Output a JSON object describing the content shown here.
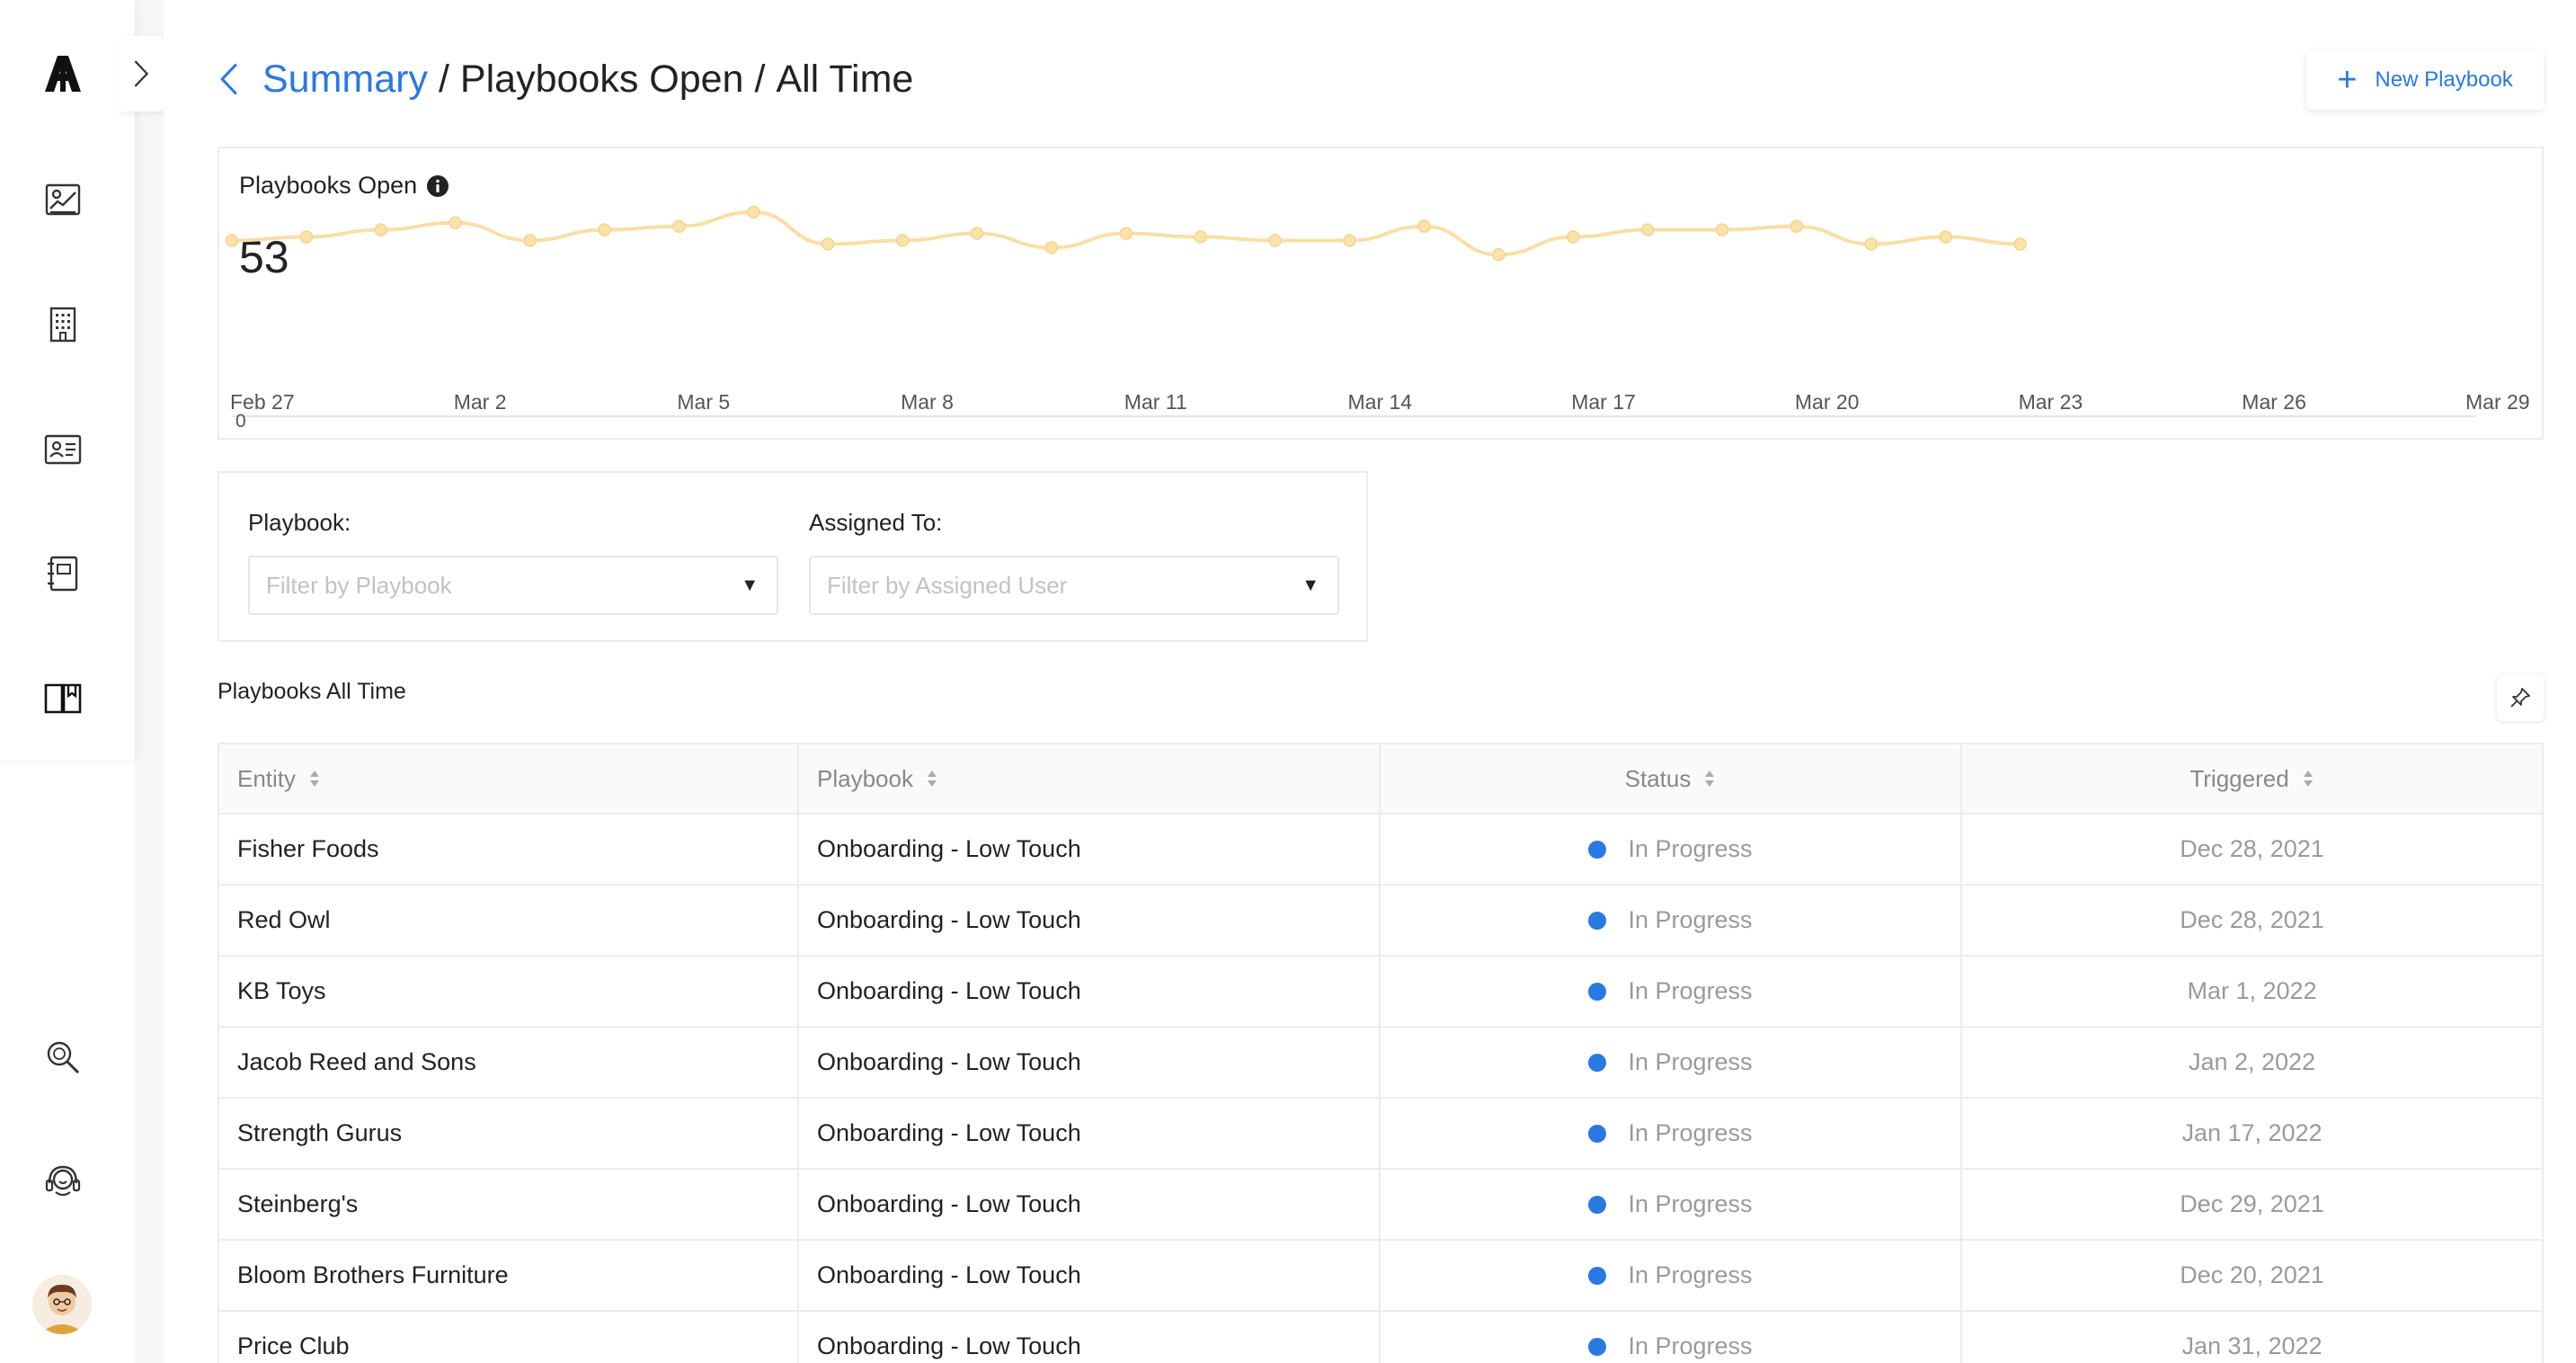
{
  "sidebar": {
    "logo": "A",
    "items": [
      {
        "name": "analytics-icon"
      },
      {
        "name": "building-icon"
      },
      {
        "name": "contacts-icon"
      },
      {
        "name": "notebook-icon"
      },
      {
        "name": "book-icon"
      }
    ],
    "bottom_items": [
      {
        "name": "search-icon"
      },
      {
        "name": "support-headset-icon"
      }
    ]
  },
  "header": {
    "breadcrumb_link": "Summary",
    "separator": "/",
    "crumb_2": "Playbooks Open",
    "crumb_3": "All Time",
    "new_button_label": "New Playbook"
  },
  "chart_card": {
    "title": "Playbooks Open",
    "value": "53"
  },
  "chart_data": {
    "type": "line",
    "x": [
      "Feb 27",
      "Feb 28",
      "Mar 1",
      "Mar 2",
      "Mar 3",
      "Mar 4",
      "Mar 5",
      "Mar 6",
      "Mar 7",
      "Mar 8",
      "Mar 9",
      "Mar 10",
      "Mar 11",
      "Mar 12",
      "Mar 13",
      "Mar 14",
      "Mar 15",
      "Mar 16",
      "Mar 17",
      "Mar 18",
      "Mar 19",
      "Mar 20",
      "Mar 21",
      "Mar 22",
      "Mar 23"
    ],
    "values": [
      50,
      51,
      53,
      55,
      50,
      53,
      54,
      58,
      49,
      50,
      52,
      48,
      52,
      51,
      50,
      50,
      54,
      46,
      51,
      53,
      53,
      54,
      49,
      51,
      49
    ],
    "x_tick_labels": [
      "Feb 27",
      "Mar 2",
      "Mar 5",
      "Mar 8",
      "Mar 11",
      "Mar 14",
      "Mar 17",
      "Mar 20",
      "Mar 23",
      "Mar 26",
      "Mar 29"
    ],
    "y_tick_labels": [
      "0"
    ],
    "line_color": "#f9dfa6",
    "grid": false
  },
  "filters": {
    "playbook_label": "Playbook:",
    "playbook_placeholder": "Filter by Playbook",
    "assigned_label": "Assigned To:",
    "assigned_placeholder": "Filter by Assigned User"
  },
  "table": {
    "title": "Playbooks All Time",
    "columns": [
      "Entity",
      "Playbook",
      "Status",
      "Triggered"
    ],
    "rows": [
      {
        "entity": "Fisher Foods",
        "playbook": "Onboarding - Low Touch",
        "status": "In Progress",
        "triggered": "Dec 28, 2021"
      },
      {
        "entity": "Red Owl",
        "playbook": "Onboarding - Low Touch",
        "status": "In Progress",
        "triggered": "Dec 28, 2021"
      },
      {
        "entity": "KB Toys",
        "playbook": "Onboarding - Low Touch",
        "status": "In Progress",
        "triggered": "Mar 1, 2022"
      },
      {
        "entity": "Jacob Reed and Sons",
        "playbook": "Onboarding - Low Touch",
        "status": "In Progress",
        "triggered": "Jan 2, 2022"
      },
      {
        "entity": "Strength Gurus",
        "playbook": "Onboarding - Low Touch",
        "status": "In Progress",
        "triggered": "Jan 17, 2022"
      },
      {
        "entity": "Steinberg's",
        "playbook": "Onboarding - Low Touch",
        "status": "In Progress",
        "triggered": "Dec 29, 2021"
      },
      {
        "entity": "Bloom Brothers Furniture",
        "playbook": "Onboarding - Low Touch",
        "status": "In Progress",
        "triggered": "Dec 20, 2021"
      },
      {
        "entity": "Price Club",
        "playbook": "Onboarding - Low Touch",
        "status": "In Progress",
        "triggered": "Jan 31, 2022"
      }
    ]
  },
  "colors": {
    "accent": "#2a79e3",
    "status_in_progress": "#2a79e3"
  }
}
